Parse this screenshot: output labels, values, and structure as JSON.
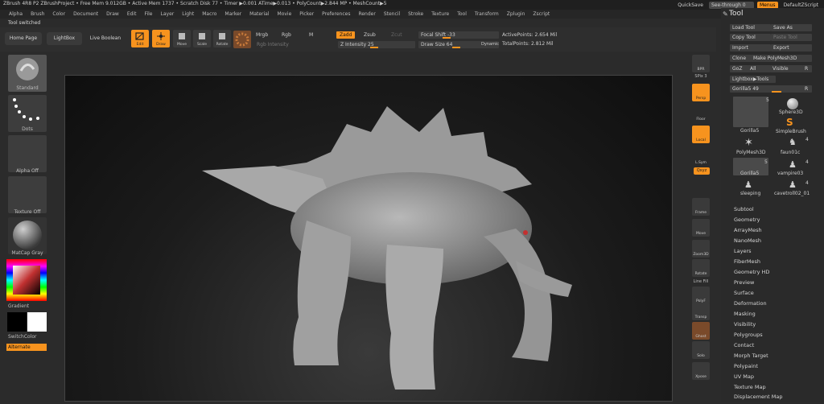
{
  "titlebar": {
    "text": "ZBrush 4R8 P2   ZBrushProject  •  Free Mem 9.012GB  •  Active Mem 1737  •  Scratch Disk 77  •  Timer ▶0.001 ATime▶0.013  •  PolyCount▶2.844 MP  •  MeshCount▶5",
    "quicksave": "QuickSave",
    "seethrough": "See-through  0",
    "menus": "Menus",
    "script": "DefaultZScript"
  },
  "menubar": [
    "Alpha",
    "Brush",
    "Color",
    "Document",
    "Draw",
    "Edit",
    "File",
    "Layer",
    "Light",
    "Macro",
    "Marker",
    "Material",
    "Movie",
    "Picker",
    "Preferences",
    "Render",
    "Stencil",
    "Stroke",
    "Texture",
    "Tool",
    "Transform",
    "Zplugin",
    "Zscript"
  ],
  "status": "Tool switched",
  "shelf": {
    "home": "Home Page",
    "lightbox": "LightBox",
    "liveboolean": "Live Boolean",
    "edit": "Edit",
    "draw": "Draw",
    "move": "Move",
    "scale": "Scale",
    "rotate": "Rotate",
    "mrgb": "Mrgb",
    "rgb": "Rgb",
    "m": "M",
    "zadd": "Zadd",
    "zsub": "Zsub",
    "zcut": "Zcut",
    "rgb_intensity": "Rgb Intensity",
    "z_intensity": "Z Intensity 25",
    "focal_shift": "Focal Shift -33",
    "draw_size": "Draw Size 64",
    "dynamic": "Dynamic",
    "active_points": "ActivePoints: 2.654 Mil",
    "total_points": "TotalPoints: 2.812 Mil"
  },
  "left_tray": {
    "brush": "Standard",
    "stroke": "Dots",
    "alpha": "Alpha Off",
    "texture": "Texture Off",
    "material": "MatCap Gray",
    "gradient": "Gradient",
    "switchcolor": "SwitchColor",
    "alternate": "Alternate"
  },
  "right_shelf": {
    "bpr": "BPR",
    "spix": "SPix 3",
    "persp": "Persp",
    "floor": "Floor",
    "local": "Local",
    "lsym": "L.Sym",
    "xyz": "Qxyz",
    "frame": "Frame",
    "move": "Move",
    "zoom3d": "Zoom3D",
    "rotate": "Rotate",
    "linefill": "Line Fill",
    "polyf": "PolyF",
    "transp": "Transp",
    "ghost": "Ghost",
    "solo": "Solo",
    "xpose": "Xpose"
  },
  "tool_palette": {
    "title": "Tool",
    "buttons": [
      [
        "Load Tool",
        "Save As"
      ],
      [
        "Copy Tool",
        "Paste Tool"
      ],
      [
        "Import",
        "Export"
      ],
      [
        "Clone",
        "Make PolyMesh3D"
      ],
      [
        "GoZ",
        "All",
        "Visible",
        "R"
      ]
    ],
    "lightbox_tools": "Lightbox▶Tools",
    "current_tool": "Gorilla5  49",
    "current_tool_r": "R",
    "thumbs": [
      {
        "label": "Gorilla5",
        "count": "5"
      },
      {
        "label": "Sphere3D",
        "count": ""
      },
      {
        "label": "SimpleBrush",
        "count": ""
      },
      {
        "label": "PolyMesh3D",
        "count": ""
      },
      {
        "label": "faun01c",
        "count": "4"
      },
      {
        "label": "Gorilla5",
        "count": "5"
      },
      {
        "label": "vampire03",
        "count": "4"
      },
      {
        "label": "sleeping",
        "count": ""
      },
      {
        "label": "cavetroll02_01",
        "count": "4"
      }
    ],
    "sections": [
      "Subtool",
      "Geometry",
      "ArrayMesh",
      "NanoMesh",
      "Layers",
      "FiberMesh",
      "Geometry HD",
      "Preview",
      "Surface",
      "Deformation",
      "Masking",
      "Visibility",
      "Polygroups",
      "Contact",
      "Morph Target",
      "Polypaint",
      "UV Map",
      "Texture Map",
      "Displacement Map"
    ]
  },
  "colors": {
    "accent": "#f7931e",
    "bg": "#2b2b2b",
    "panel": "#3a3a3a"
  }
}
